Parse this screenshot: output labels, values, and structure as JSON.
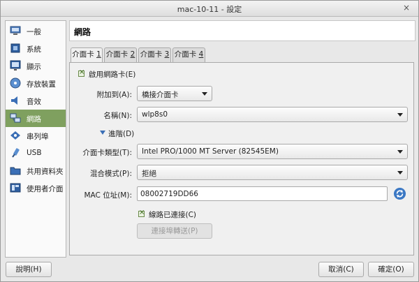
{
  "window": {
    "title": "mac-10-11 - 設定",
    "close_glyph": "×"
  },
  "sidebar": {
    "items": [
      {
        "label": "一般",
        "icon": "general-icon"
      },
      {
        "label": "系統",
        "icon": "system-icon"
      },
      {
        "label": "顯示",
        "icon": "display-icon"
      },
      {
        "label": "存放裝置",
        "icon": "storage-icon"
      },
      {
        "label": "音效",
        "icon": "audio-icon"
      },
      {
        "label": "網路",
        "icon": "network-icon",
        "active": true
      },
      {
        "label": "串列埠",
        "icon": "serial-port-icon"
      },
      {
        "label": "USB",
        "icon": "usb-icon"
      },
      {
        "label": "共用資料夾",
        "icon": "shared-folder-icon"
      },
      {
        "label": "使用者介面",
        "icon": "user-interface-icon"
      }
    ]
  },
  "header": {
    "title": "網路"
  },
  "tabs": [
    {
      "label": "介面卡 ",
      "key": "1"
    },
    {
      "label": "介面卡 ",
      "key": "2"
    },
    {
      "label": "介面卡 ",
      "key": "3"
    },
    {
      "label": "介面卡 ",
      "key": "4"
    }
  ],
  "form": {
    "enable_adapter": "啟用網路卡(E)",
    "attached_to_label": "附加到(A):",
    "attached_to_value": "橋接介面卡",
    "name_label": "名稱(N):",
    "name_value": "wlp8s0",
    "advanced_label": "進階(D)",
    "adapter_type_label": "介面卡類型(T):",
    "adapter_type_value": "Intel PRO/1000 MT Server (82545EM)",
    "promiscuous_label": "混合模式(P):",
    "promiscuous_value": "拒絕",
    "mac_label": "MAC 位址(M):",
    "mac_value": "08002719DD66",
    "cable_connected": "線路已連接(C)",
    "port_forwarding": "連接埠轉送(P)"
  },
  "footer": {
    "help": "說明(H)",
    "cancel": "取消(C)",
    "ok": "確定(O)"
  },
  "colors": {
    "accent": "#7fa05f",
    "refresh": "#3b78c4"
  }
}
